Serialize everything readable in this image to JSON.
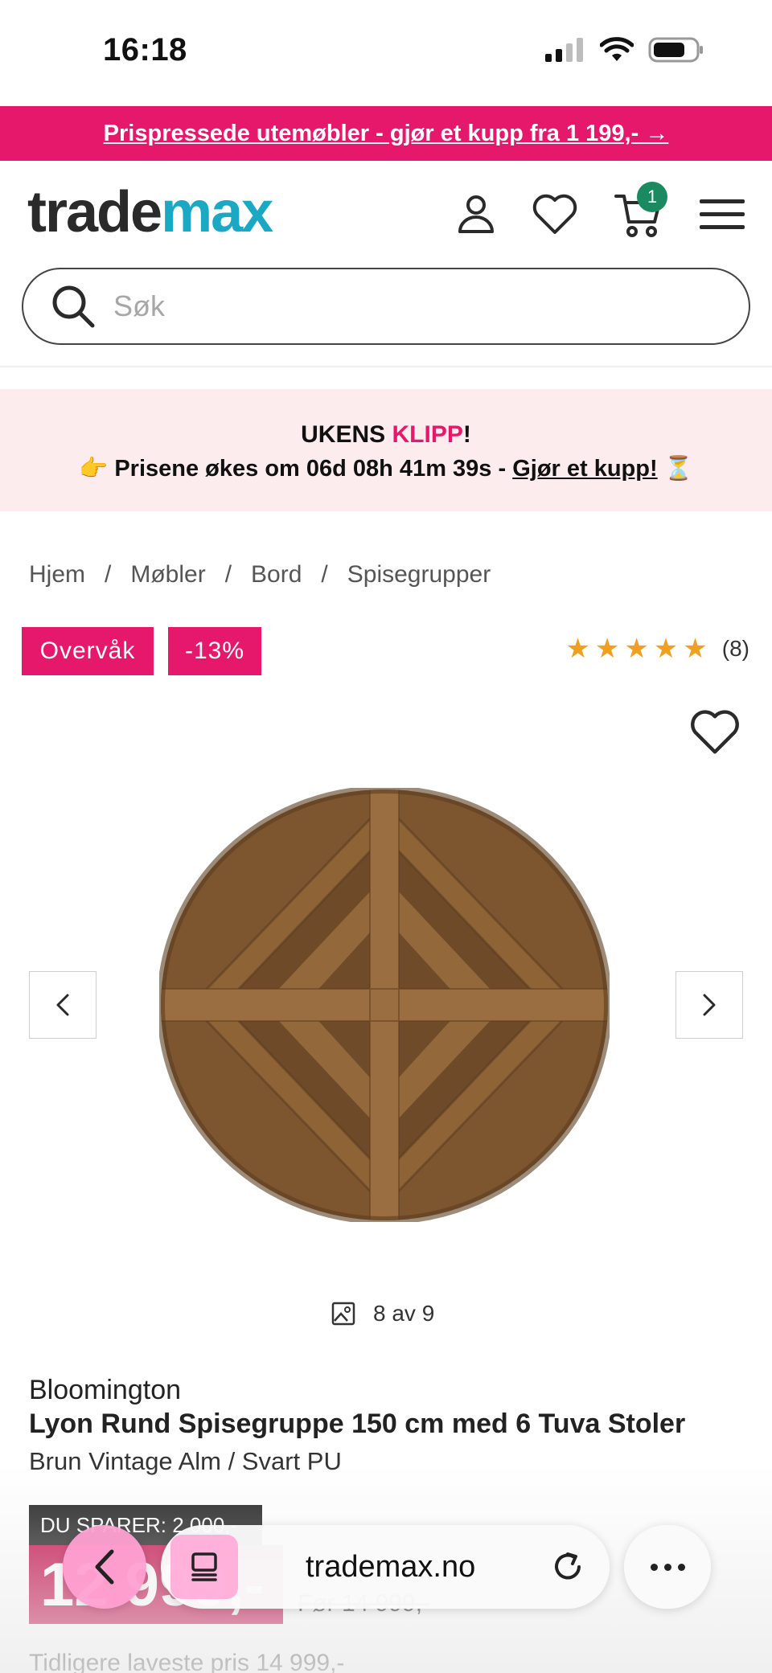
{
  "status_bar": {
    "time": "16:18"
  },
  "promo": {
    "text": "Prispressede utemøbler - gjør et kupp fra 1 199,- →"
  },
  "header": {
    "logo_part1": "trade",
    "logo_part2": "max",
    "cart_count": "1",
    "icons": [
      "user-icon",
      "heart-icon",
      "cart-icon",
      "menu-icon"
    ]
  },
  "search": {
    "placeholder": "Søk"
  },
  "deal": {
    "title_prefix": "UKENS ",
    "title_highlight": "KLIPP",
    "title_suffix": "!",
    "line_prefix": "👉 Prisene økes om 06d 08h 41m 39s - ",
    "line_link": "Gjør et kupp!",
    "line_suffix": " ⏳"
  },
  "breadcrumb": {
    "items": [
      "Hjem",
      "Møbler",
      "Bord",
      "Spisegrupper"
    ],
    "separator": "/"
  },
  "badges": {
    "watch": "Overvåk",
    "discount": "-13%"
  },
  "rating": {
    "stars": 5,
    "count": "(8)"
  },
  "gallery": {
    "counter": "8 av 9"
  },
  "product": {
    "brand": "Bloomington",
    "title": "Lyon Rund Spisegruppe 150 cm med 6 Tuva Stoler",
    "variant": "Brun Vintage Alm / Svart PU",
    "savings": "DU SPARER: 2 000,-",
    "price": "12 999,-",
    "old_price": "Før 14 999,-",
    "lowest_price": "Tidligere laveste pris 14 999,-"
  },
  "browser": {
    "url": "trademax.no"
  },
  "colors": {
    "brand_pink": "#e5186b",
    "logo_teal": "#1aa8c5",
    "cart_green": "#1b8a61",
    "star": "#f0a020"
  }
}
